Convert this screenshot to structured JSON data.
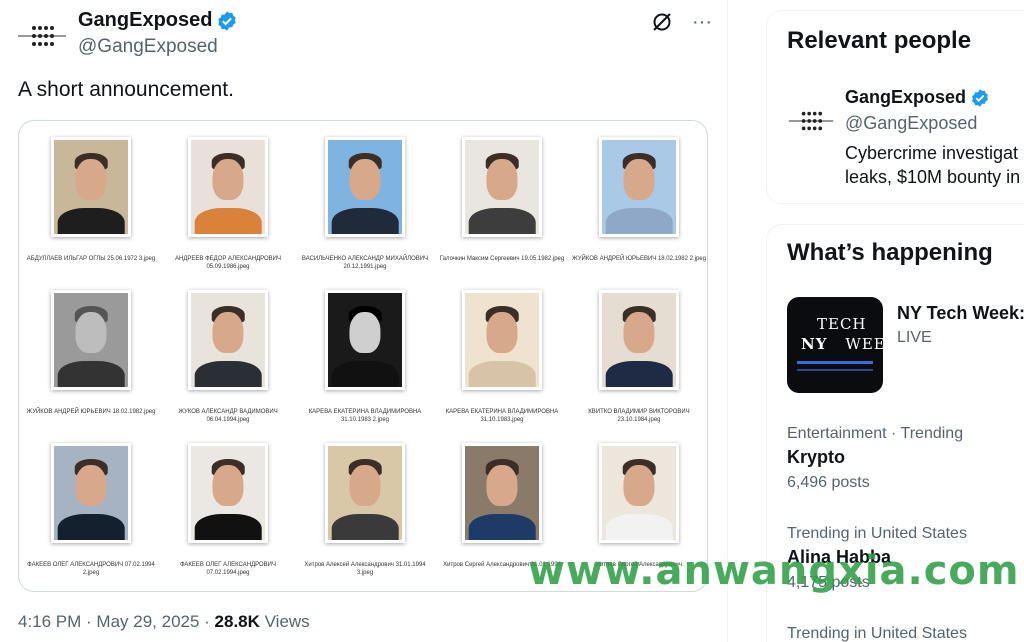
{
  "tweet": {
    "author_name": "GangExposed",
    "author_handle": "@GangExposed",
    "text": "A short announcement.",
    "timestamp": "4:16 PM · May 29, 2025 · ",
    "views_count": "28.8K",
    "views_label": " Views",
    "icons": [
      "grok-icon",
      "more-icon"
    ]
  },
  "media": {
    "captions": [
      "АБДУЛЛАЕВ ИЛЬГАР ОГЛЫ 25.06.1972 3.jpeg",
      "АНДРЕЕВ ФЕДОР АЛЕКСАНДРОВИЧ 05.09.1986.jpeg",
      "ВАСИЛЬЧЕНКО АЛЕКСАНДР МИХАЙЛОВИЧ 20.12.1991.jpeg",
      "Галочкин Максим Сергеевич 19.05.1982.jpeg",
      "ЖУЙКОВ АНДРЕЙ ЮРЬЕВИЧ 18.02.1982 2.jpeg",
      "ЖУЙКОВ АНДРЕЙ ЮРЬЕВИЧ 18.02.1982.jpeg",
      "ЖУКОВ АЛЕКСАНДР ВАДИМОВИЧ 06.04.1994.jpeg",
      "КАРЕВА ЕКАТЕРИНА ВЛАДИМИРОВНА 31.10.1983 2.jpeg",
      "КАРЕВА ЕКАТЕРИНА ВЛАДИМИРОВНА 31.10.1983.jpeg",
      "КВИТКО ВЛАДИМИР ВИКТОРОВИЧ 23.10.1984.jpeg",
      "ФАКЕЕВ ОЛЕГ АЛЕКСАНДРОВИЧ 07.02.1994 2.jpeg",
      "ФАКЕЕВ ОЛЕГ АЛЕКСАНДРОВИЧ 07.02.1994.jpeg",
      "Хитров Алексей Александрович 31.01.1994 3.jpeg",
      "Хитров Сергей Александрович 31.01.1994",
      "Хитров Сергей Александрович"
    ]
  },
  "sidebar": {
    "relevant_people": {
      "title": "Relevant people",
      "name": "GangExposed",
      "handle": "@GangExposed",
      "bio_line1": "Cybercrime investigat",
      "bio_line2": "leaks, $10M bounty in"
    },
    "whats_happening": {
      "title": "What’s happening",
      "event": {
        "title": "NY Tech Week:",
        "status": "LIVE",
        "thumb_line1": "TECH",
        "thumb_line2a": "NY",
        "thumb_line2b": "WEEK"
      },
      "trends": [
        {
          "context": "Entertainment · Trending",
          "name": "Krypto",
          "posts": "6,496 posts"
        },
        {
          "context": "Trending in United States",
          "name": "Alina Habba",
          "posts": "4,175 posts"
        },
        {
          "context": "Trending in United States",
          "name": "",
          "posts": ""
        }
      ]
    }
  },
  "watermark": "www.anwangxia.com",
  "colors": {
    "verified": "#1d9bf0",
    "watermark": "#2e9f47",
    "muted": "#536471"
  }
}
